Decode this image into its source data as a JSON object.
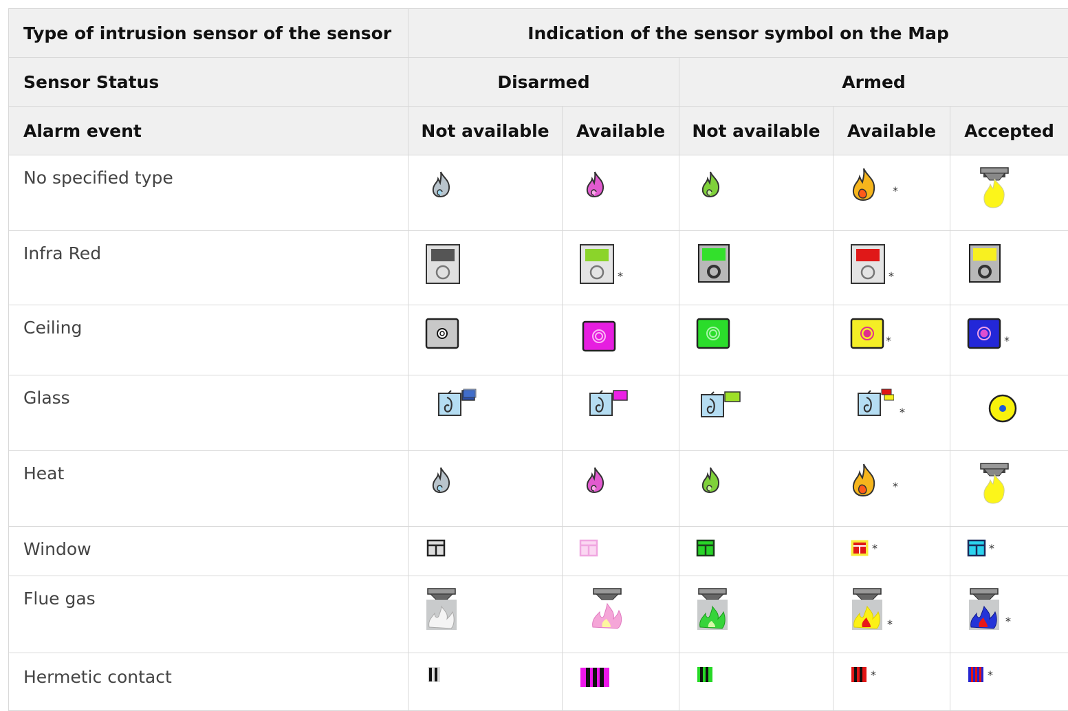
{
  "header": {
    "type_label": "Type of intrusion sensor of the sensor",
    "indication_label": "Indication of the sensor symbol on the Map",
    "status_label": "Sensor Status",
    "disarmed_label": "Disarmed",
    "armed_label": "Armed",
    "alarm_label": "Alarm event",
    "col_disarmed_na": "Not available",
    "col_disarmed_av": "Available",
    "col_armed_na": "Not available",
    "col_armed_av": "Available",
    "col_armed_acc": "Accepted"
  },
  "rows": [
    {
      "label": "No specified type",
      "icons": [
        "flame-gray-icon",
        "flame-magenta-icon",
        "flame-green-icon",
        "flame-orange-icon",
        "fire-detector-yellow-icon"
      ],
      "star": "*"
    },
    {
      "label": "Infra Red",
      "icons": [
        "infrared-gray-icon",
        "infrared-green-icon",
        "infrared-green-dark-icon",
        "infrared-red-icon",
        "infrared-yellow-icon"
      ],
      "star": "*"
    },
    {
      "label": "Ceiling",
      "icons": [
        "ceiling-gray-icon",
        "ceiling-magenta-icon",
        "ceiling-green-icon",
        "ceiling-yellow-icon",
        "ceiling-blue-icon"
      ],
      "star": "*"
    },
    {
      "label": "Glass",
      "icons": [
        "glass-blue-icon",
        "glass-magenta-icon",
        "glass-green-icon",
        "glass-red-icon",
        "glass-accepted-circle-icon"
      ],
      "star": "*"
    },
    {
      "label": "Heat",
      "icons": [
        "flame-gray-icon",
        "flame-magenta-icon",
        "flame-green-icon",
        "flame-orange-icon",
        "fire-detector-yellow-icon"
      ],
      "star": "*"
    },
    {
      "label": "Window",
      "icons": [
        "window-gray-icon",
        "window-pink-icon",
        "window-green-icon",
        "window-red-icon",
        "window-cyan-icon"
      ],
      "star": "*"
    },
    {
      "label": "Flue gas",
      "icons": [
        "smoke-gray-icon",
        "smoke-pink-icon",
        "smoke-green-icon",
        "smoke-yellow-icon",
        "smoke-blue-icon"
      ],
      "star": "*"
    },
    {
      "label": "Hermetic contact",
      "icons": [
        "contact-black-icon",
        "contact-magenta-icon",
        "contact-green-icon",
        "contact-red-icon",
        "contact-blue-icon"
      ],
      "star": "*"
    }
  ],
  "colors": {
    "header_bg": "#f0f0f0",
    "border": "#d8d8d8",
    "magenta": "#e81fe0",
    "green": "#22c922",
    "yellow": "#f2f022",
    "red": "#d41414",
    "blue": "#2222cc",
    "cyan": "#22c8e0"
  }
}
